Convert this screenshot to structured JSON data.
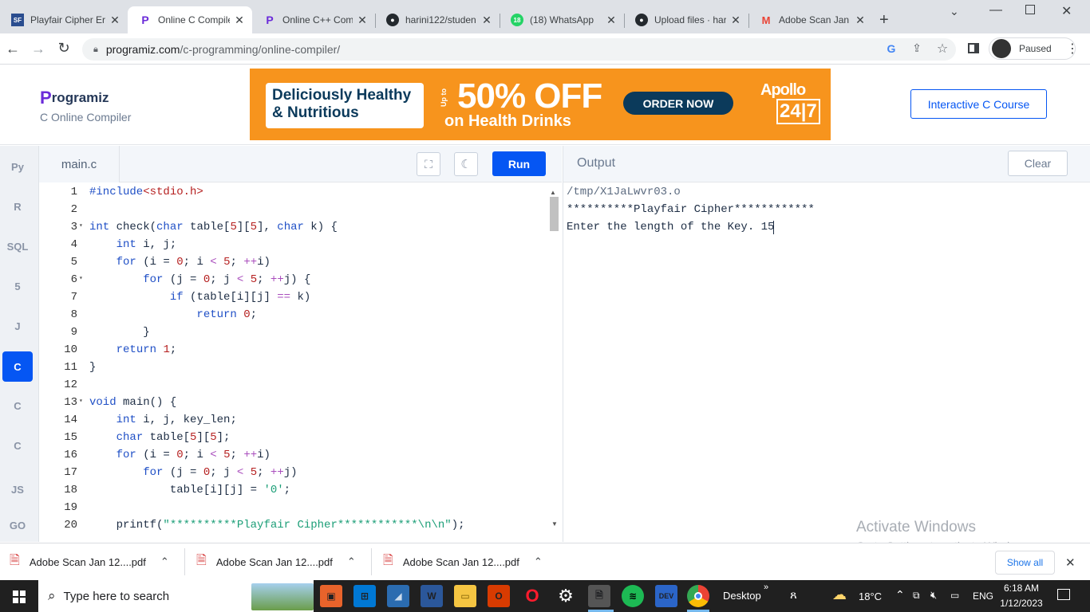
{
  "browser": {
    "tabs": [
      {
        "title": "Playfair Cipher Er",
        "icon": "sf-icon",
        "active": false
      },
      {
        "title": "Online C Compile",
        "icon": "programiz-icon",
        "active": true
      },
      {
        "title": "Online C++ Com",
        "icon": "programiz-icon",
        "active": false
      },
      {
        "title": "harini122/studen",
        "icon": "github-icon",
        "active": false
      },
      {
        "title": "(18) WhatsApp",
        "icon": "whatsapp-icon",
        "active": false
      },
      {
        "title": "Upload files · har",
        "icon": "github-icon",
        "active": false
      },
      {
        "title": "Adobe Scan Jan",
        "icon": "gmail-icon",
        "active": false
      }
    ],
    "url_host": "programiz.com",
    "url_path": "/c-programming/online-compiler/",
    "profile_status": "Paused"
  },
  "site": {
    "logo_text": "rogramiz",
    "logo_letter": "P",
    "subtitle": "C Online Compiler",
    "course_button": "Interactive C Course",
    "ad": {
      "headline_line1": "Deliciously Healthy",
      "headline_line2": "& Nutritious",
      "upto": "Up to",
      "discount": "50% OFF",
      "sub": "on Health Drinks",
      "cta": "ORDER NOW",
      "brand_top": "Apollo",
      "brand_bottom": "24|7"
    }
  },
  "languages": [
    {
      "name": "python-icon",
      "label": "Py"
    },
    {
      "name": "r-icon",
      "label": "R"
    },
    {
      "name": "sql-icon",
      "label": "SQL"
    },
    {
      "name": "html5-icon",
      "label": "5"
    },
    {
      "name": "java-icon",
      "label": "J"
    },
    {
      "name": "c-icon",
      "label": "C"
    },
    {
      "name": "cpp-icon",
      "label": "C"
    },
    {
      "name": "csharp-icon",
      "label": "C"
    },
    {
      "name": "js-icon",
      "label": "JS"
    },
    {
      "name": "go-icon",
      "label": "GO"
    }
  ],
  "editor": {
    "filename": "main.c",
    "run_label": "Run",
    "lines": [
      "#include<stdio.h>",
      "",
      "int check(char table[5][5], char k) {",
      "    int i, j;",
      "    for (i = 0; i < 5; ++i)",
      "        for (j = 0; j < 5; ++j) {",
      "            if (table[i][j] == k)",
      "                return 0;",
      "        }",
      "    return 1;",
      "}",
      "",
      "void main() {",
      "    int i, j, key_len;",
      "    char table[5][5];",
      "    for (i = 0; i < 5; ++i)",
      "        for (j = 0; j < 5; ++j)",
      "            table[i][j] = '0';",
      "",
      "    printf(\"**********Playfair Cipher************\\n\\n\");"
    ]
  },
  "output": {
    "title": "Output",
    "clear_label": "Clear",
    "lines": [
      "/tmp/X1JaLwvr03.o",
      "**********Playfair Cipher************",
      "Enter the length of the Key. 15"
    ]
  },
  "watermark": {
    "line1": "Activate Windows",
    "line2": "Go to Settings to activate Windows."
  },
  "downloads": {
    "items": [
      "Adobe Scan Jan 12....pdf",
      "Adobe Scan Jan 12....pdf",
      "Adobe Scan Jan 12....pdf"
    ],
    "show_all": "Show all"
  },
  "taskbar": {
    "search_placeholder": "Type here to search",
    "desktop_label": "Desktop",
    "weather": "18°C",
    "language": "ENG",
    "time": "6:18 AM",
    "date": "1/12/2023"
  }
}
